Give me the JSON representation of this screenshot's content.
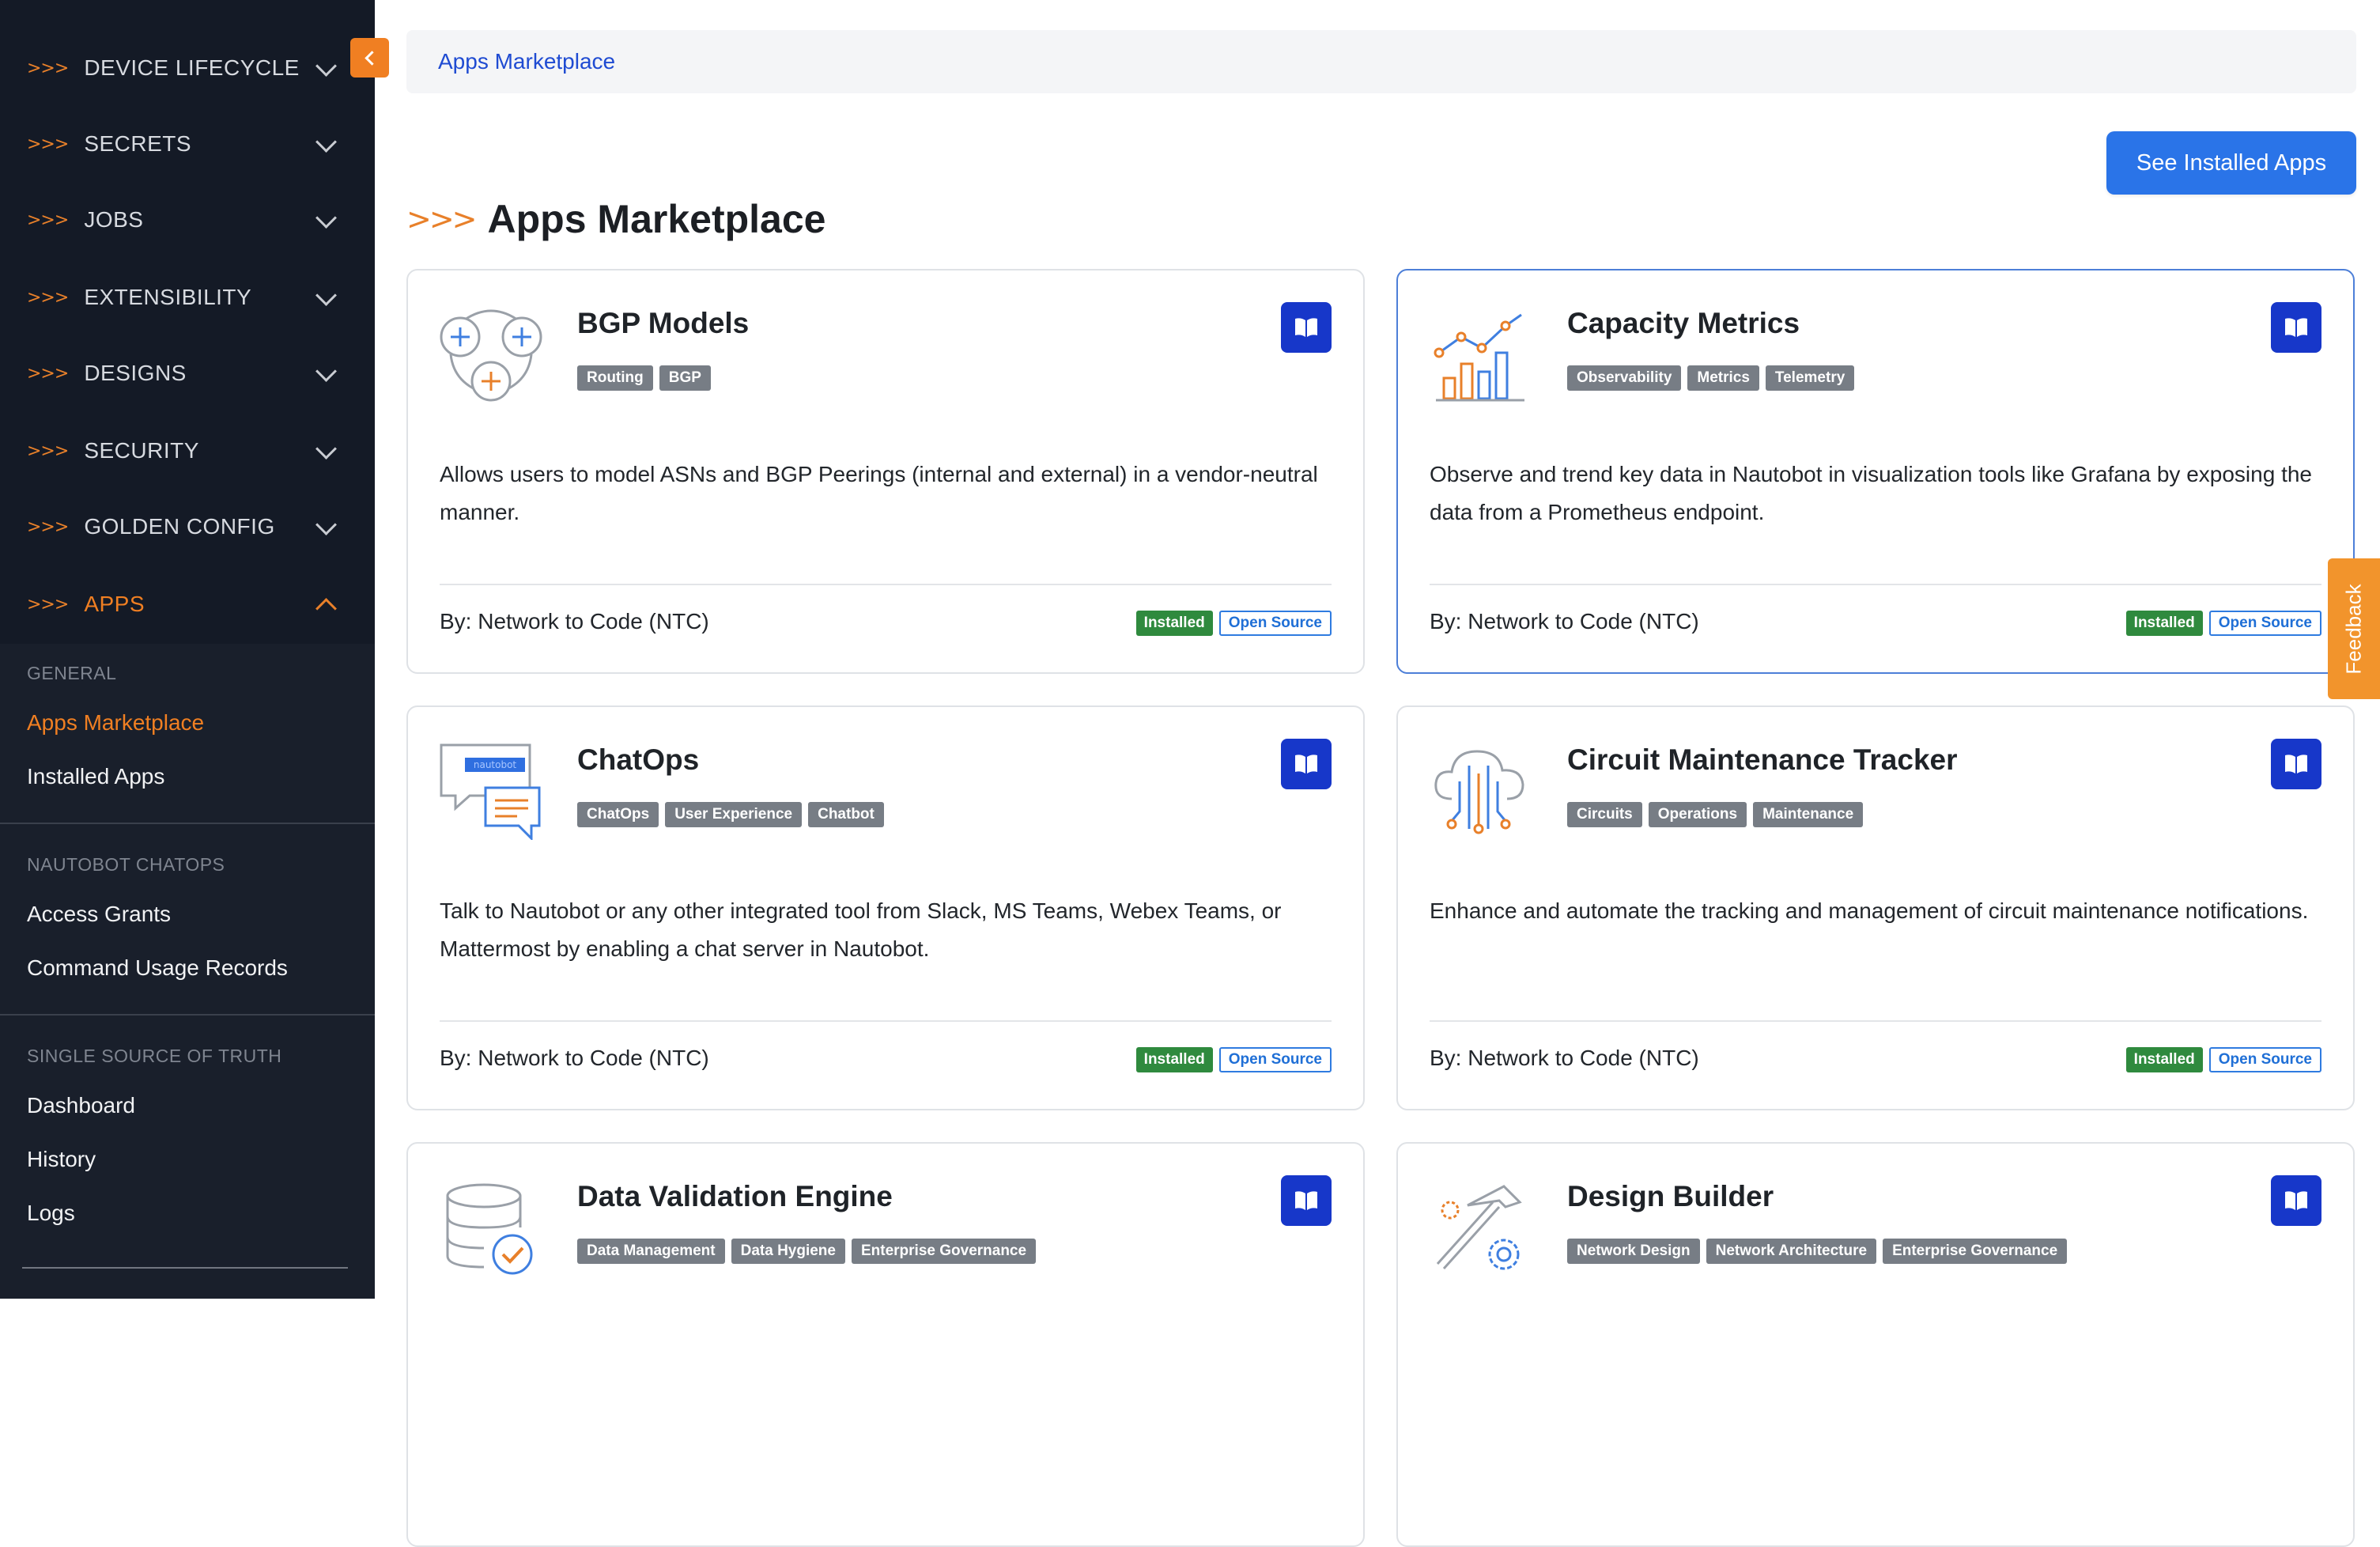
{
  "sidebar": {
    "nav_prefix": ">>>",
    "items": [
      {
        "label": "DEVICE LIFECYCLE"
      },
      {
        "label": "SECRETS"
      },
      {
        "label": "JOBS"
      },
      {
        "label": "EXTENSIBILITY"
      },
      {
        "label": "DESIGNS"
      },
      {
        "label": "SECURITY"
      },
      {
        "label": "GOLDEN CONFIG"
      },
      {
        "label": "APPS"
      }
    ],
    "sections": [
      {
        "title": "GENERAL",
        "links": [
          "Apps Marketplace",
          "Installed Apps"
        ]
      },
      {
        "title": "NAUTOBOT CHATOPS",
        "links": [
          "Access Grants",
          "Command Usage Records"
        ]
      },
      {
        "title": "SINGLE SOURCE OF TRUTH",
        "links": [
          "Dashboard",
          "History",
          "Logs"
        ]
      }
    ],
    "accent": "#f07f22",
    "background": "#141a26"
  },
  "breadcrumb": {
    "label": "Apps Marketplace"
  },
  "header": {
    "title_prefix": ">>>",
    "title": "Apps Marketplace",
    "installed_button": "See Installed Apps"
  },
  "cards": [
    {
      "title": "BGP Models",
      "icon": "bgp-icon",
      "tags": [
        "Routing",
        "BGP"
      ],
      "description": "Allows users to model ASNs and BGP Peerings (internal and external) in a vendor-neutral manner.",
      "author": "By: Network to Code (NTC)",
      "badge_installed": "Installed",
      "badge_license": "Open Source"
    },
    {
      "title": "Capacity Metrics",
      "icon": "metrics-chart-icon",
      "tags": [
        "Observability",
        "Metrics",
        "Telemetry"
      ],
      "description": "Observe and trend key data in Nautobot in visualization tools like Grafana by exposing the data from a Prometheus endpoint.",
      "author": "By: Network to Code (NTC)",
      "badge_installed": "Installed",
      "badge_license": "Open Source"
    },
    {
      "title": "ChatOps",
      "icon": "chat-bubbles-icon",
      "icon_text": "nautobot",
      "tags": [
        "ChatOps",
        "User Experience",
        "Chatbot"
      ],
      "description": "Talk to Nautobot or any other integrated tool from Slack, MS Teams, Webex Teams, or Mattermost by enabling a chat server in Nautobot.",
      "author": "By: Network to Code (NTC)",
      "badge_installed": "Installed",
      "badge_license": "Open Source"
    },
    {
      "title": "Circuit Maintenance Tracker",
      "icon": "cloud-circuit-icon",
      "tags": [
        "Circuits",
        "Operations",
        "Maintenance"
      ],
      "description": "Enhance and automate the tracking and management of circuit maintenance notifications.",
      "author": "By: Network to Code (NTC)",
      "badge_installed": "Installed",
      "badge_license": "Open Source"
    },
    {
      "title": "Data Validation Engine",
      "icon": "database-check-icon",
      "tags": [
        "Data Management",
        "Data Hygiene",
        "Enterprise Governance"
      ]
    },
    {
      "title": "Design Builder",
      "icon": "hammer-gear-icon",
      "tags": [
        "Network Design",
        "Network Architecture",
        "Enterprise Governance"
      ]
    }
  ],
  "feedback": {
    "label": "Feedback"
  },
  "colors": {
    "primary_button": "#2a74e8",
    "doc_button": "#1737c9",
    "installed_badge": "#2f8a3e",
    "open_source_badge": "#1f6fd6",
    "tag": "#777d85"
  }
}
